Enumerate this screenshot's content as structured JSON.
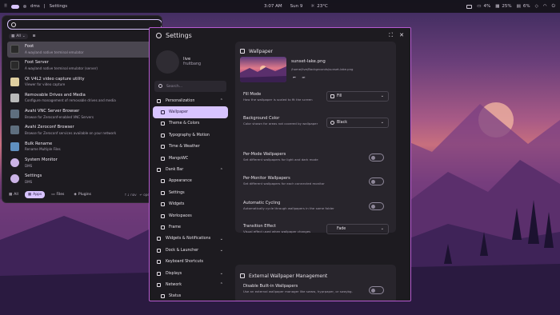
{
  "topbar": {
    "distro": "dms",
    "active_app": "Settings",
    "time": "3:07 AM",
    "date": "Sun 9",
    "weather": "23°C",
    "battery": "4%",
    "cpu": "25%",
    "ram": "6%"
  },
  "launcher": {
    "filter_label": "All",
    "items": [
      {
        "name": "Foot",
        "desc": "A wayland native terminal emulator",
        "icon": "terminal-icon",
        "color": "#2a2a2a"
      },
      {
        "name": "Foot Server",
        "desc": "A wayland native terminal emulator (server)",
        "icon": "terminal-icon",
        "color": "#2a2a2a"
      },
      {
        "name": "Qt V4L2 video capture utility",
        "desc": "Viewer for video capture",
        "icon": "camera-icon",
        "color": "#e0cfa0"
      },
      {
        "name": "Removable Drives and Media",
        "desc": "Configure management of removable drives and media",
        "icon": "drive-icon",
        "color": "#b9b9b9"
      },
      {
        "name": "Avahi VNC Server Browser",
        "desc": "Browse for Zeroconf-enabled VNC Servers",
        "icon": "network-icon",
        "color": "#5e6e7e"
      },
      {
        "name": "Avahi Zeroconf Browser",
        "desc": "Browse for Zeroconf services available on your network",
        "icon": "network-icon",
        "color": "#5e6e7e"
      },
      {
        "name": "Bulk Rename",
        "desc": "Rename Multiple Files",
        "icon": "rename-icon",
        "color": "#5f8fbf"
      },
      {
        "name": "System Monitor",
        "desc": "DMS",
        "icon": "dms-icon",
        "color": "#cbb3e6"
      },
      {
        "name": "Settings",
        "desc": "DMS",
        "icon": "dms-icon",
        "color": "#cbb3e6"
      }
    ],
    "tabs": [
      "All",
      "Apps",
      "Files",
      "Plugins"
    ],
    "hint_nav": "↑↓ nav",
    "hint_open": "↵ open",
    "hint_tab": "Tab"
  },
  "settings": {
    "title": "Settings",
    "user": {
      "name": "live",
      "host": "fruitbang"
    },
    "search_placeholder": "Search...",
    "nav": [
      {
        "label": "Personalization",
        "level": "top",
        "chev": "⌃"
      },
      {
        "label": "Wallpaper",
        "level": "sub",
        "active": true
      },
      {
        "label": "Theme & Colors",
        "level": "sub"
      },
      {
        "label": "Typography & Motion",
        "level": "sub"
      },
      {
        "label": "Time & Weather",
        "level": "sub"
      },
      {
        "label": "MangoWC",
        "level": "sub"
      },
      {
        "label": "Dank Bar",
        "level": "top",
        "chev": "⌃"
      },
      {
        "label": "Appearance",
        "level": "sub"
      },
      {
        "label": "Settings",
        "level": "sub"
      },
      {
        "label": "Widgets",
        "level": "sub"
      },
      {
        "label": "Workspaces",
        "level": "sub"
      },
      {
        "label": "Frame",
        "level": "sub"
      },
      {
        "label": "Widgets & Notifications",
        "level": "top",
        "chev": "⌄"
      },
      {
        "label": "Dock & Launcher",
        "level": "top",
        "chev": "⌄"
      },
      {
        "label": "Keyboard Shortcuts",
        "level": "top"
      },
      {
        "label": "Displays",
        "level": "top",
        "chev": "⌄"
      },
      {
        "label": "Network",
        "level": "top",
        "chev": "⌃"
      },
      {
        "label": "Status",
        "level": "sub"
      }
    ],
    "wallpaper": {
      "heading": "Wallpaper",
      "file": "sunset-lake.png",
      "path": "/home/live/Backgrounds/sunset-lake.png",
      "fill_mode": {
        "label": "Fill Mode",
        "desc": "How the wallpaper is scaled to fit the screen",
        "value": "Fill"
      },
      "bg_color": {
        "label": "Background Color",
        "desc": "Color shown for areas not covered by wallpaper",
        "value": "Black"
      },
      "per_mode": {
        "label": "Per-Mode Wallpapers",
        "desc": "Set different wallpapers for light and dark mode"
      },
      "per_monitor": {
        "label": "Per-Monitor Wallpapers",
        "desc": "Set different wallpapers for each connected monitor"
      },
      "cycling": {
        "label": "Automatic Cycling",
        "desc": "Automatically cycle through wallpapers in the same folder"
      },
      "transition": {
        "label": "Transition Effect",
        "desc": "Visual effect used when wallpaper changes",
        "value": "Fade"
      }
    },
    "external": {
      "heading": "External Wallpaper Management",
      "disable_builtin": {
        "label": "Disable Built-in Wallpapers",
        "desc": "Use an external wallpaper manager like swww, hyprpaper, or swaybg."
      }
    }
  }
}
